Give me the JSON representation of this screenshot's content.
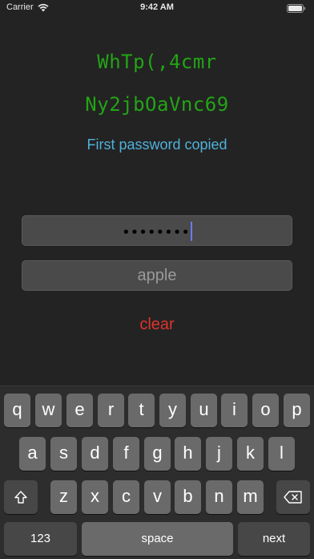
{
  "status_bar": {
    "carrier": "Carrier",
    "time": "9:42 AM"
  },
  "passwords": {
    "first": "WhTp(,4cmr",
    "second": "Ny2jbOaVnc69"
  },
  "status_message": "First password copied",
  "password_field": {
    "dots": "••••••••"
  },
  "salt_field": {
    "placeholder": "apple"
  },
  "clear_label": "clear",
  "keyboard": {
    "row1": [
      "q",
      "w",
      "e",
      "r",
      "t",
      "y",
      "u",
      "i",
      "o",
      "p"
    ],
    "row2": [
      "a",
      "s",
      "d",
      "f",
      "g",
      "h",
      "j",
      "k",
      "l"
    ],
    "row3": [
      "z",
      "x",
      "c",
      "v",
      "b",
      "n",
      "m"
    ],
    "numbers_label": "123",
    "space_label": "space",
    "next_label": "next",
    "icons": {
      "shift": "shift-icon",
      "delete": "delete-icon"
    }
  },
  "colors": {
    "background": "#232323",
    "password_green": "#23a416",
    "status_blue": "#4fb0da",
    "clear_red": "#e0332c",
    "cursor": "#6c7bf2"
  }
}
